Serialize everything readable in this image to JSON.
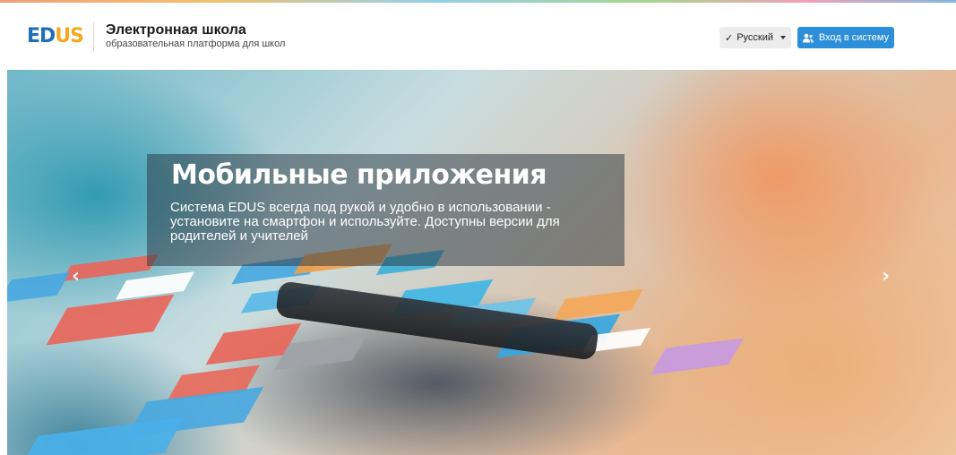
{
  "header": {
    "logo": {
      "part1": "ED",
      "part2": "US"
    },
    "title": "Электронная школа",
    "subtitle": "образовательная платформа для школ",
    "language_button": {
      "check": "✓",
      "label": "Русский"
    },
    "login_button": {
      "label": "Вход в систему",
      "icon": "user-icon"
    }
  },
  "slider": {
    "title": "Мобильные приложения",
    "text": "Система EDUS всегда под рукой и удобно в использовании - установите на смартфон и используйте. Доступны версии для родителей и учителей",
    "prev_icon": "‹",
    "next_icon": "›"
  },
  "colors": {
    "login_button": "#2d8fd9",
    "logo_blue": "#1f6fb5",
    "logo_orange": "#f3a81f"
  }
}
